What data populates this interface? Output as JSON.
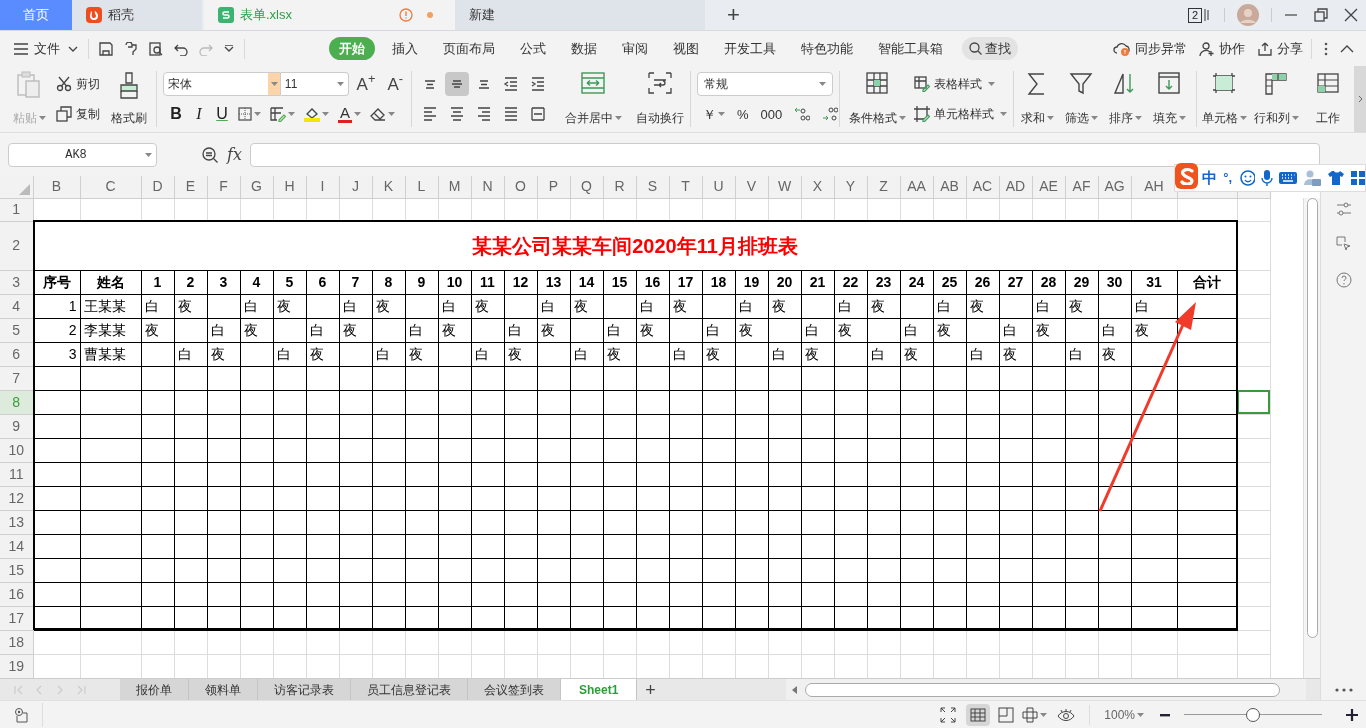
{
  "window_tabs": [
    {
      "kind": "home",
      "label": "首页",
      "selected": false
    },
    {
      "kind": "docer",
      "label": "稻壳",
      "selected": false
    },
    {
      "kind": "sheet",
      "label": "表单.xlsx",
      "selected": true,
      "unsaved": true
    },
    {
      "kind": "new",
      "label": "新建",
      "selected": false
    }
  ],
  "new_tab_button": "+",
  "window_count": "2",
  "menu": {
    "file": "文件",
    "tabs": [
      {
        "label": "开始",
        "selected": true
      },
      {
        "label": "插入",
        "selected": false
      },
      {
        "label": "页面布局",
        "selected": false
      },
      {
        "label": "公式",
        "selected": false
      },
      {
        "label": "数据",
        "selected": false
      },
      {
        "label": "审阅",
        "selected": false
      },
      {
        "label": "视图",
        "selected": false
      },
      {
        "label": "开发工具",
        "selected": false
      },
      {
        "label": "特色功能",
        "selected": false
      },
      {
        "label": "智能工具箱",
        "selected": false
      }
    ],
    "search": "查找",
    "actions": [
      {
        "kind": "sync",
        "label": "同步异常"
      },
      {
        "kind": "collab",
        "label": "协作"
      },
      {
        "kind": "share",
        "label": "分享"
      }
    ]
  },
  "ribbon": {
    "paste": {
      "label": "粘贴",
      "disabled": true
    },
    "cut": "剪切",
    "copy": "复制",
    "format_painter": "格式刷",
    "font_name": "宋体",
    "font_size": "11",
    "grow_font": "A$^{+}$",
    "shrink_font": "A$^{-}$",
    "text_styles": [
      {
        "kind": "bold",
        "label": "B"
      },
      {
        "kind": "italic",
        "label": "I"
      },
      {
        "kind": "underline",
        "label": "U"
      }
    ],
    "font_color": "A",
    "alignment": [
      {
        "kind": "top",
        "selected": false
      },
      {
        "kind": "middle",
        "selected": true
      },
      {
        "kind": "bottom",
        "selected": false
      },
      {
        "kind": "outdent",
        "selected": false
      },
      {
        "kind": "indent",
        "selected": false
      },
      {
        "kind": "left",
        "selected": false
      },
      {
        "kind": "center",
        "selected": false
      },
      {
        "kind": "right",
        "selected": false
      },
      {
        "kind": "justify",
        "selected": false
      },
      {
        "kind": "distributed",
        "selected": false
      }
    ],
    "merge": "合并居中",
    "wrap": "自动换行",
    "number_format": "常规",
    "number_symbols": [
      "￥",
      "%",
      "000"
    ],
    "conditional_format": "条件格式",
    "table_style": "表格样式",
    "cell_style": "单元格样式",
    "tools": [
      {
        "kind": "sum",
        "label": "求和"
      },
      {
        "kind": "filter",
        "label": "筛选"
      },
      {
        "kind": "sort",
        "label": "排序"
      },
      {
        "kind": "fill",
        "label": "填充"
      },
      {
        "kind": "cell",
        "label": "单元格"
      },
      {
        "kind": "rowcol",
        "label": "行和列"
      },
      {
        "kind": "sheet",
        "label": "工作"
      }
    ]
  },
  "name_box": "AK8",
  "formula_label": "fx",
  "ime": {
    "labels": [
      "中",
      "°,"
    ]
  },
  "sheet": {
    "columns": [
      "B",
      "C",
      "D",
      "E",
      "F",
      "G",
      "H",
      "I",
      "J",
      "K",
      "L",
      "M",
      "N",
      "O",
      "P",
      "Q",
      "R",
      "S",
      "T",
      "U",
      "V",
      "W",
      "X",
      "Y",
      "Z",
      "AA",
      "AB",
      "AC",
      "AD",
      "AE",
      "AF",
      "AG",
      "AH"
    ],
    "rows": [
      {
        "label": "1",
        "selected": false
      },
      {
        "label": "2",
        "selected": false
      },
      {
        "label": "3",
        "selected": false
      },
      {
        "label": "4",
        "selected": false
      },
      {
        "label": "5",
        "selected": false
      },
      {
        "label": "6",
        "selected": false
      },
      {
        "label": "7",
        "selected": false
      },
      {
        "label": "8",
        "selected": true
      },
      {
        "label": "9",
        "selected": false
      },
      {
        "label": "10",
        "selected": false
      },
      {
        "label": "11",
        "selected": false
      },
      {
        "label": "12",
        "selected": false
      },
      {
        "label": "13",
        "selected": false
      },
      {
        "label": "14",
        "selected": false
      },
      {
        "label": "15",
        "selected": false
      },
      {
        "label": "16",
        "selected": false
      },
      {
        "label": "17",
        "selected": false
      },
      {
        "label": "18",
        "selected": false
      },
      {
        "label": "19",
        "selected": false
      }
    ],
    "title": "某某公司某某车间2020年11月排班表",
    "header": [
      "序号",
      "姓名",
      "1",
      "2",
      "3",
      "4",
      "5",
      "6",
      "7",
      "8",
      "9",
      "10",
      "11",
      "12",
      "13",
      "14",
      "15",
      "16",
      "17",
      "18",
      "19",
      "20",
      "21",
      "22",
      "23",
      "24",
      "25",
      "26",
      "27",
      "28",
      "29",
      "30",
      "31",
      "合计"
    ],
    "records": [
      {
        "no": "1",
        "name": "王某某",
        "days": [
          {
            "kind": "shift",
            "label": "白"
          },
          {
            "kind": "shift",
            "label": "夜"
          },
          {
            "kind": "off"
          },
          {
            "kind": "shift",
            "label": "白"
          },
          {
            "kind": "shift",
            "label": "夜"
          },
          {
            "kind": "off"
          },
          {
            "kind": "shift",
            "label": "白"
          },
          {
            "kind": "shift",
            "label": "夜"
          },
          {
            "kind": "off"
          },
          {
            "kind": "shift",
            "label": "白"
          },
          {
            "kind": "shift",
            "label": "夜"
          },
          {
            "kind": "off"
          },
          {
            "kind": "shift",
            "label": "白"
          },
          {
            "kind": "shift",
            "label": "夜"
          },
          {
            "kind": "off"
          },
          {
            "kind": "shift",
            "label": "白"
          },
          {
            "kind": "shift",
            "label": "夜"
          },
          {
            "kind": "off"
          },
          {
            "kind": "shift",
            "label": "白"
          },
          {
            "kind": "shift",
            "label": "夜"
          },
          {
            "kind": "off"
          },
          {
            "kind": "shift",
            "label": "白"
          },
          {
            "kind": "shift",
            "label": "夜"
          },
          {
            "kind": "off"
          },
          {
            "kind": "shift",
            "label": "白"
          },
          {
            "kind": "shift",
            "label": "夜"
          },
          {
            "kind": "off"
          },
          {
            "kind": "shift",
            "label": "白"
          },
          {
            "kind": "shift",
            "label": "夜"
          },
          {
            "kind": "off"
          },
          {
            "kind": "shift",
            "label": "白"
          }
        ]
      },
      {
        "no": "2",
        "name": "李某某",
        "days": [
          {
            "kind": "shift",
            "label": "夜"
          },
          {
            "kind": "off"
          },
          {
            "kind": "shift",
            "label": "白"
          },
          {
            "kind": "shift",
            "label": "夜"
          },
          {
            "kind": "off"
          },
          {
            "kind": "shift",
            "label": "白"
          },
          {
            "kind": "shift",
            "label": "夜"
          },
          {
            "kind": "off"
          },
          {
            "kind": "shift",
            "label": "白"
          },
          {
            "kind": "shift",
            "label": "夜"
          },
          {
            "kind": "off"
          },
          {
            "kind": "shift",
            "label": "白"
          },
          {
            "kind": "shift",
            "label": "夜"
          },
          {
            "kind": "off"
          },
          {
            "kind": "shift",
            "label": "白"
          },
          {
            "kind": "shift",
            "label": "夜"
          },
          {
            "kind": "off"
          },
          {
            "kind": "shift",
            "label": "白"
          },
          {
            "kind": "shift",
            "label": "夜"
          },
          {
            "kind": "off"
          },
          {
            "kind": "shift",
            "label": "白"
          },
          {
            "kind": "shift",
            "label": "夜"
          },
          {
            "kind": "off"
          },
          {
            "kind": "shift",
            "label": "白"
          },
          {
            "kind": "shift",
            "label": "夜"
          },
          {
            "kind": "off"
          },
          {
            "kind": "shift",
            "label": "白"
          },
          {
            "kind": "shift",
            "label": "夜"
          },
          {
            "kind": "off"
          },
          {
            "kind": "shift",
            "label": "白"
          },
          {
            "kind": "shift",
            "label": "夜"
          }
        ]
      },
      {
        "no": "3",
        "name": "曹某某",
        "days": [
          {
            "kind": "off"
          },
          {
            "kind": "shift",
            "label": "白"
          },
          {
            "kind": "shift",
            "label": "夜"
          },
          {
            "kind": "off"
          },
          {
            "kind": "shift",
            "label": "白"
          },
          {
            "kind": "shift",
            "label": "夜"
          },
          {
            "kind": "off"
          },
          {
            "kind": "shift",
            "label": "白"
          },
          {
            "kind": "shift",
            "label": "夜"
          },
          {
            "kind": "off"
          },
          {
            "kind": "shift",
            "label": "白"
          },
          {
            "kind": "shift",
            "label": "夜"
          },
          {
            "kind": "off"
          },
          {
            "kind": "shift",
            "label": "白"
          },
          {
            "kind": "shift",
            "label": "夜"
          },
          {
            "kind": "off"
          },
          {
            "kind": "shift",
            "label": "白"
          },
          {
            "kind": "shift",
            "label": "夜"
          },
          {
            "kind": "off"
          },
          {
            "kind": "shift",
            "label": "白"
          },
          {
            "kind": "shift",
            "label": "夜"
          },
          {
            "kind": "off"
          },
          {
            "kind": "shift",
            "label": "白"
          },
          {
            "kind": "shift",
            "label": "夜"
          },
          {
            "kind": "off"
          },
          {
            "kind": "shift",
            "label": "白"
          },
          {
            "kind": "shift",
            "label": "夜"
          },
          {
            "kind": "off"
          },
          {
            "kind": "shift",
            "label": "白"
          },
          {
            "kind": "shift",
            "label": "夜"
          },
          {
            "kind": "off"
          }
        ]
      }
    ]
  },
  "sheet_tabs": [
    {
      "label": "报价单",
      "selected": false
    },
    {
      "label": "领料单",
      "selected": false
    },
    {
      "label": "访客记录表",
      "selected": false
    },
    {
      "label": "员工信息登记表",
      "selected": false
    },
    {
      "label": "会议签到表",
      "selected": false
    },
    {
      "label": "Sheet1",
      "selected": true
    }
  ],
  "add_sheet": "+",
  "status": {
    "zoom": "100%",
    "zoom_slider": {
      "level": 0.5
    }
  }
}
